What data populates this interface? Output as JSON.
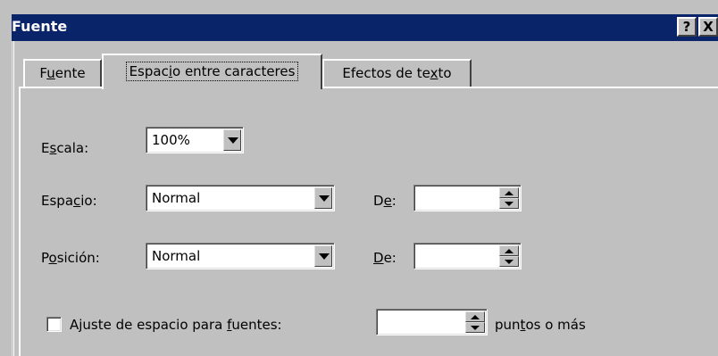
{
  "window": {
    "title": "Fuente",
    "help_button": "?",
    "close_button": "X",
    "title_bar_color": "#0a246a",
    "face_color": "#c0c0c0"
  },
  "tabs": [
    {
      "pre": "F",
      "mn": "u",
      "post": "ente",
      "selected": false
    },
    {
      "pre": "Espac",
      "mn": "i",
      "post": "o entre caracteres",
      "selected": true
    },
    {
      "pre": "Efectos de te",
      "mn": "x",
      "post": "to",
      "selected": false
    }
  ],
  "scale": {
    "label": {
      "pre": "E",
      "mn": "s",
      "post": "cala:"
    },
    "value": "100%"
  },
  "spacing": {
    "label": {
      "pre": "Espa",
      "mn": "c",
      "post": "io:"
    },
    "value": "Normal",
    "by_label": {
      "pre": "D",
      "mn": "e",
      "post": ":"
    },
    "by_value": ""
  },
  "position": {
    "label": {
      "pre": "P",
      "mn": "o",
      "post": "sición:"
    },
    "value": "Normal",
    "by_label": {
      "pre": "",
      "mn": "D",
      "post": "e:"
    },
    "by_value": ""
  },
  "kerning": {
    "checked": false,
    "label": {
      "pre": "Ajuste de espacio para ",
      "mn": "f",
      "post": "uentes:"
    },
    "value": "",
    "suffix": {
      "pre": "pun",
      "mn": "t",
      "post": "os o más"
    }
  }
}
